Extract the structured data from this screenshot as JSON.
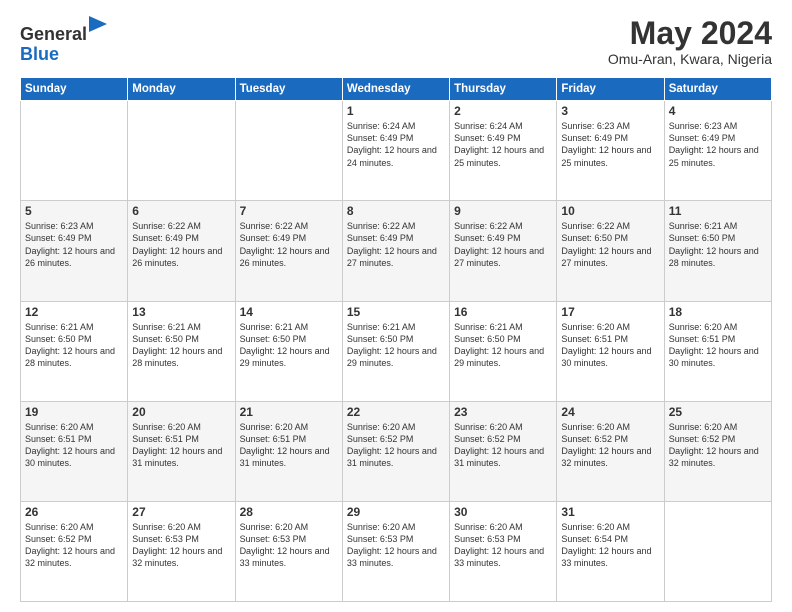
{
  "logo": {
    "line1": "General",
    "line2": "Blue"
  },
  "title": "May 2024",
  "subtitle": "Omu-Aran, Kwara, Nigeria",
  "weekdays": [
    "Sunday",
    "Monday",
    "Tuesday",
    "Wednesday",
    "Thursday",
    "Friday",
    "Saturday"
  ],
  "weeks": [
    [
      {
        "day": "",
        "info": ""
      },
      {
        "day": "",
        "info": ""
      },
      {
        "day": "",
        "info": ""
      },
      {
        "day": "1",
        "info": "Sunrise: 6:24 AM\nSunset: 6:49 PM\nDaylight: 12 hours\nand 24 minutes."
      },
      {
        "day": "2",
        "info": "Sunrise: 6:24 AM\nSunset: 6:49 PM\nDaylight: 12 hours\nand 25 minutes."
      },
      {
        "day": "3",
        "info": "Sunrise: 6:23 AM\nSunset: 6:49 PM\nDaylight: 12 hours\nand 25 minutes."
      },
      {
        "day": "4",
        "info": "Sunrise: 6:23 AM\nSunset: 6:49 PM\nDaylight: 12 hours\nand 25 minutes."
      }
    ],
    [
      {
        "day": "5",
        "info": "Sunrise: 6:23 AM\nSunset: 6:49 PM\nDaylight: 12 hours\nand 26 minutes."
      },
      {
        "day": "6",
        "info": "Sunrise: 6:22 AM\nSunset: 6:49 PM\nDaylight: 12 hours\nand 26 minutes."
      },
      {
        "day": "7",
        "info": "Sunrise: 6:22 AM\nSunset: 6:49 PM\nDaylight: 12 hours\nand 26 minutes."
      },
      {
        "day": "8",
        "info": "Sunrise: 6:22 AM\nSunset: 6:49 PM\nDaylight: 12 hours\nand 27 minutes."
      },
      {
        "day": "9",
        "info": "Sunrise: 6:22 AM\nSunset: 6:49 PM\nDaylight: 12 hours\nand 27 minutes."
      },
      {
        "day": "10",
        "info": "Sunrise: 6:22 AM\nSunset: 6:50 PM\nDaylight: 12 hours\nand 27 minutes."
      },
      {
        "day": "11",
        "info": "Sunrise: 6:21 AM\nSunset: 6:50 PM\nDaylight: 12 hours\nand 28 minutes."
      }
    ],
    [
      {
        "day": "12",
        "info": "Sunrise: 6:21 AM\nSunset: 6:50 PM\nDaylight: 12 hours\nand 28 minutes."
      },
      {
        "day": "13",
        "info": "Sunrise: 6:21 AM\nSunset: 6:50 PM\nDaylight: 12 hours\nand 28 minutes."
      },
      {
        "day": "14",
        "info": "Sunrise: 6:21 AM\nSunset: 6:50 PM\nDaylight: 12 hours\nand 29 minutes."
      },
      {
        "day": "15",
        "info": "Sunrise: 6:21 AM\nSunset: 6:50 PM\nDaylight: 12 hours\nand 29 minutes."
      },
      {
        "day": "16",
        "info": "Sunrise: 6:21 AM\nSunset: 6:50 PM\nDaylight: 12 hours\nand 29 minutes."
      },
      {
        "day": "17",
        "info": "Sunrise: 6:20 AM\nSunset: 6:51 PM\nDaylight: 12 hours\nand 30 minutes."
      },
      {
        "day": "18",
        "info": "Sunrise: 6:20 AM\nSunset: 6:51 PM\nDaylight: 12 hours\nand 30 minutes."
      }
    ],
    [
      {
        "day": "19",
        "info": "Sunrise: 6:20 AM\nSunset: 6:51 PM\nDaylight: 12 hours\nand 30 minutes."
      },
      {
        "day": "20",
        "info": "Sunrise: 6:20 AM\nSunset: 6:51 PM\nDaylight: 12 hours\nand 31 minutes."
      },
      {
        "day": "21",
        "info": "Sunrise: 6:20 AM\nSunset: 6:51 PM\nDaylight: 12 hours\nand 31 minutes."
      },
      {
        "day": "22",
        "info": "Sunrise: 6:20 AM\nSunset: 6:52 PM\nDaylight: 12 hours\nand 31 minutes."
      },
      {
        "day": "23",
        "info": "Sunrise: 6:20 AM\nSunset: 6:52 PM\nDaylight: 12 hours\nand 31 minutes."
      },
      {
        "day": "24",
        "info": "Sunrise: 6:20 AM\nSunset: 6:52 PM\nDaylight: 12 hours\nand 32 minutes."
      },
      {
        "day": "25",
        "info": "Sunrise: 6:20 AM\nSunset: 6:52 PM\nDaylight: 12 hours\nand 32 minutes."
      }
    ],
    [
      {
        "day": "26",
        "info": "Sunrise: 6:20 AM\nSunset: 6:52 PM\nDaylight: 12 hours\nand 32 minutes."
      },
      {
        "day": "27",
        "info": "Sunrise: 6:20 AM\nSunset: 6:53 PM\nDaylight: 12 hours\nand 32 minutes."
      },
      {
        "day": "28",
        "info": "Sunrise: 6:20 AM\nSunset: 6:53 PM\nDaylight: 12 hours\nand 33 minutes."
      },
      {
        "day": "29",
        "info": "Sunrise: 6:20 AM\nSunset: 6:53 PM\nDaylight: 12 hours\nand 33 minutes."
      },
      {
        "day": "30",
        "info": "Sunrise: 6:20 AM\nSunset: 6:53 PM\nDaylight: 12 hours\nand 33 minutes."
      },
      {
        "day": "31",
        "info": "Sunrise: 6:20 AM\nSunset: 6:54 PM\nDaylight: 12 hours\nand 33 minutes."
      },
      {
        "day": "",
        "info": ""
      }
    ]
  ],
  "colors": {
    "header_bg": "#1a6bbf",
    "header_text": "#ffffff",
    "accent": "#1a6bbf"
  }
}
